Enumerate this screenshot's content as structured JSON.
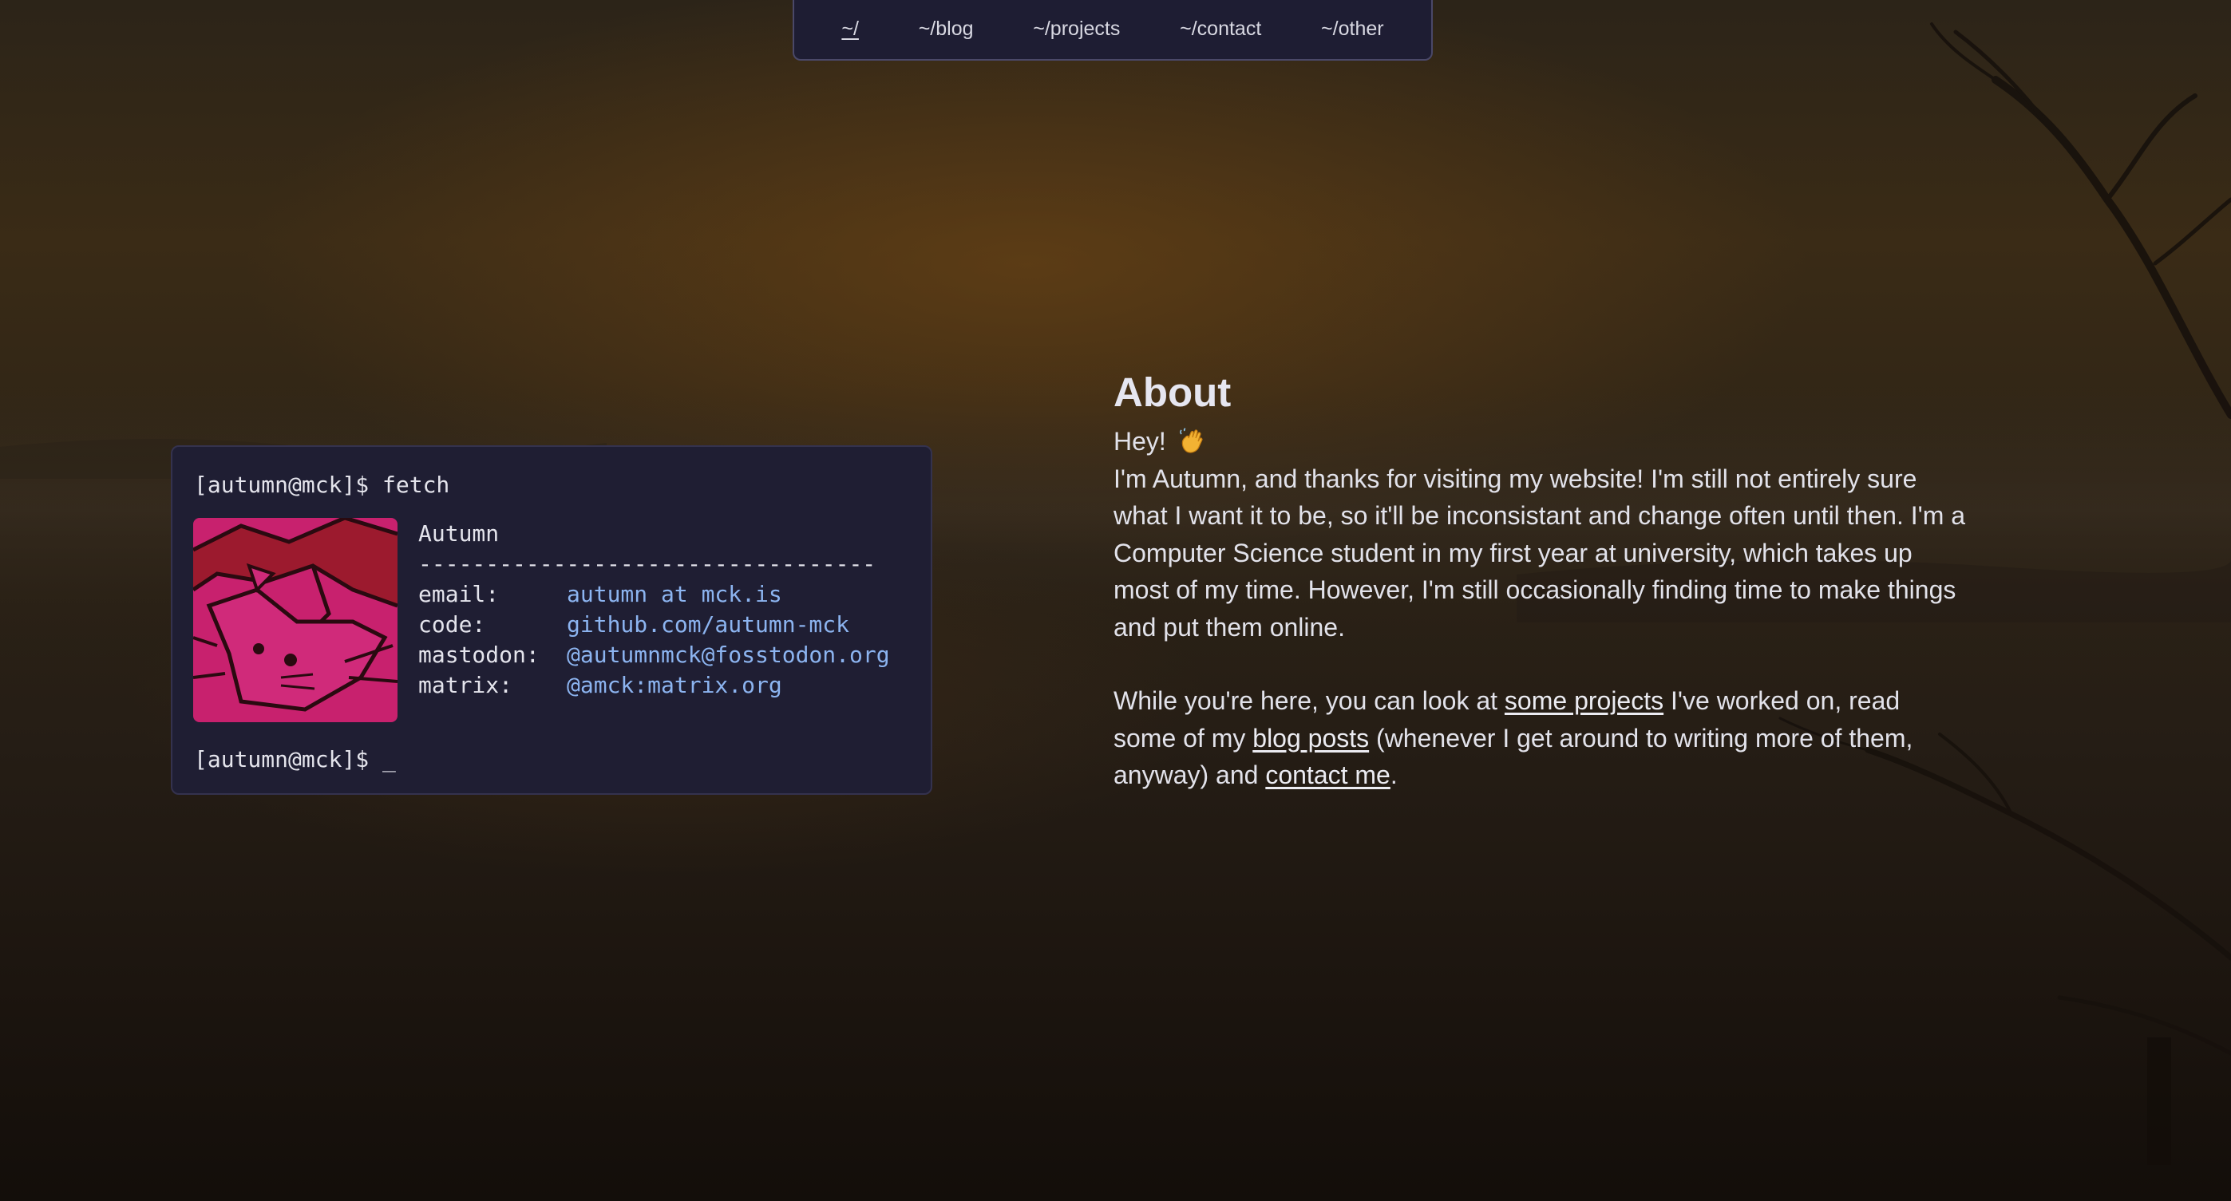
{
  "nav": {
    "items": [
      {
        "label": "~/",
        "active": true
      },
      {
        "label": "~/blog"
      },
      {
        "label": "~/projects"
      },
      {
        "label": "~/contact"
      },
      {
        "label": "~/other"
      }
    ]
  },
  "terminal": {
    "command_line": "[autumn@mck]$ fetch",
    "prompt": "[autumn@mck]$ ",
    "cursor": "_",
    "name": "Autumn",
    "separator": "----------------------------------",
    "fields": [
      {
        "key": "email:",
        "value": "autumn at mck.is"
      },
      {
        "key": "code:",
        "value": "github.com/autumn-mck"
      },
      {
        "key": "mastodon:",
        "value": "@autumnmck@fosstodon.org"
      },
      {
        "key": "matrix:",
        "value": "@amck:matrix.org"
      }
    ]
  },
  "about": {
    "title": "About",
    "greeting": "Hey!",
    "greeting_icon": "waving-hand-icon",
    "para1": "I'm Autumn, and thanks for visiting my website! I'm still not entirely sure what I want it to be, so it'll be inconsistant and change often until then. I'm a Computer Science student in my first year at university, which takes up most of my time. However, I'm still occasionally finding time to make things and put them online.",
    "para2": {
      "t1": "While you're here, you can look at ",
      "link1": "some projects",
      "t2": " I've worked on, read some of my ",
      "link2": "blog posts",
      "t3": " (whenever I get around to writing more of them, anyway) and ",
      "link3": "contact me",
      "t4": "."
    }
  },
  "colors": {
    "panel_bg": "#1f1e33",
    "link_blue": "#8cb4f0",
    "avatar_pink": "#c8216e",
    "avatar_red": "#8b1a1a"
  }
}
